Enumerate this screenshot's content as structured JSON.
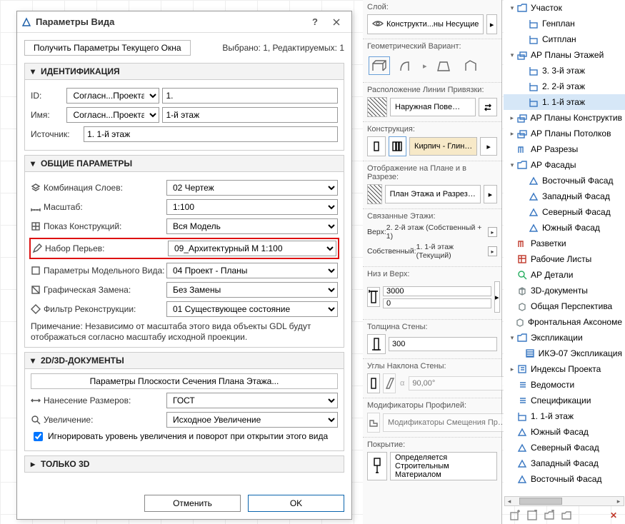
{
  "dialog": {
    "title": "Параметры Вида",
    "get_current": "Получить Параметры Текущего Окна",
    "selection_info": "Выбрано: 1, Редактируемых: 1",
    "section_ident": "ИДЕНТИФИКАЦИЯ",
    "id_label": "ID:",
    "id_mode": "Согласн...Проекта",
    "id_value": "1.",
    "name_label": "Имя:",
    "name_mode": "Согласн...Проекта",
    "name_value": "1-й этаж",
    "source_label": "Источник:",
    "source_value": "1. 1-й этаж",
    "section_general": "ОБЩИЕ ПАРАМЕТРЫ",
    "layers_label": "Комбинация Слоев:",
    "layers_value": "02 Чертеж",
    "scale_label": "Масштаб:",
    "scale_value": "1:100",
    "construct_label": "Показ Конструкций:",
    "construct_value": "Вся Модель",
    "pens_label": "Набор Перьев:",
    "pens_value": "09_Архитектурный М 1:100",
    "mvo_label": "Параметры Модельного Вида:",
    "mvo_value": "04 Проект - Планы",
    "go_label": "Графическая Замена:",
    "go_value": "Без Замены",
    "renov_label": "Фильтр Реконструкции:",
    "renov_value": "01 Существующее состояние",
    "note": "Примечание: Независимо от масштаба этого вида объекты GDL будут отображаться согласно масштабу исходной проекции.",
    "section_2d3d": "2D/3D-ДОКУМЕНТЫ",
    "floorplan_cut_btn": "Параметры Плоскости Сечения Плана Этажа...",
    "dims_label": "Нанесение Размеров:",
    "dims_value": "ГОСТ",
    "zoom_label": "Увеличение:",
    "zoom_value": "Исходное Увеличение",
    "ignore_zoom_chk": "Игнорировать уровень увеличения и поворот при открытии этого вида",
    "section_3donly": "ТОЛЬКО 3D",
    "cancel": "Отменить",
    "ok": "OK"
  },
  "props": {
    "layer_label": "Слой:",
    "layer_value": "Конструкти...ны Несущие",
    "geom_label": "Геометрический Вариант:",
    "refline_label": "Расположение Линии Привязки:",
    "refline_value": "Наружная Пове…",
    "construction_label": "Конструкция:",
    "construction_value": "Кирпич - Глин…",
    "display_label": "Отображение на Плане и в Разрезе:",
    "display_value": "План Этажа и Разрез…",
    "linked_label": "Связанные Этажи:",
    "top_label": "Верх:",
    "top_value": "2. 2-й этаж (Собственный + 1)",
    "own_label": "Собственный:",
    "own_value": "1. 1-й этаж (Текущий)",
    "bottop_label": "Низ и Верх:",
    "h_top": "3000",
    "h_bot": "0",
    "thickness_label": "Толщина Стены:",
    "thickness_value": "300",
    "slant_label": "Углы Наклона Стены:",
    "slant_value": "90,00°",
    "profmod_label": "Модификаторы Профилей:",
    "profmod_value": "Модификаторы Смещения Пр…",
    "surface_label": "Покрытие:",
    "surface_value": "Определяется Строительным Материалом"
  },
  "tree": [
    {
      "indent": 0,
      "caret": "down",
      "iconColor": "#3a78c2",
      "icon": "folder",
      "label": "Участок"
    },
    {
      "indent": 1,
      "caret": "",
      "iconColor": "#3a78c2",
      "icon": "plan",
      "label": "Генплан"
    },
    {
      "indent": 1,
      "caret": "",
      "iconColor": "#3a78c2",
      "icon": "plan",
      "label": "Ситплан"
    },
    {
      "indent": 0,
      "caret": "down",
      "iconColor": "#3a78c2",
      "icon": "plans",
      "label": "АР Планы Этажей"
    },
    {
      "indent": 1,
      "caret": "",
      "iconColor": "#3a78c2",
      "icon": "plan",
      "label": "3. 3-й этаж"
    },
    {
      "indent": 1,
      "caret": "",
      "iconColor": "#3a78c2",
      "icon": "plan",
      "label": "2. 2-й этаж"
    },
    {
      "indent": 1,
      "caret": "",
      "iconColor": "#3a78c2",
      "icon": "plan",
      "label": "1. 1-й этаж",
      "selected": true
    },
    {
      "indent": 0,
      "caret": "right",
      "iconColor": "#3a78c2",
      "icon": "plans",
      "label": "АР Планы Конструктив"
    },
    {
      "indent": 0,
      "caret": "right",
      "iconColor": "#3a78c2",
      "icon": "plans",
      "label": "АР Планы Потолков"
    },
    {
      "indent": 0,
      "caret": "",
      "iconColor": "#3a78c2",
      "icon": "section",
      "label": "АР Разрезы"
    },
    {
      "indent": 0,
      "caret": "down",
      "iconColor": "#3a78c2",
      "icon": "folder",
      "label": "АР Фасады"
    },
    {
      "indent": 1,
      "caret": "",
      "iconColor": "#3a78c2",
      "icon": "elev",
      "label": "Восточный Фасад"
    },
    {
      "indent": 1,
      "caret": "",
      "iconColor": "#3a78c2",
      "icon": "elev",
      "label": "Западный Фасад"
    },
    {
      "indent": 1,
      "caret": "",
      "iconColor": "#3a78c2",
      "icon": "elev",
      "label": "Северный Фасад"
    },
    {
      "indent": 1,
      "caret": "",
      "iconColor": "#3a78c2",
      "icon": "elev",
      "label": "Южный Фасад"
    },
    {
      "indent": 0,
      "caret": "",
      "iconColor": "#c0392b",
      "icon": "section",
      "label": "Разветки"
    },
    {
      "indent": 0,
      "caret": "",
      "iconColor": "#c0392b",
      "icon": "worksheet",
      "label": "Рабочие Листы"
    },
    {
      "indent": 0,
      "caret": "",
      "iconColor": "#27ae60",
      "icon": "detail",
      "label": "АР Детали"
    },
    {
      "indent": 0,
      "caret": "",
      "iconColor": "#7f8c8d",
      "icon": "3ddoc",
      "label": "3D-документы"
    },
    {
      "indent": 0,
      "caret": "",
      "iconColor": "#7f8c8d",
      "icon": "3d",
      "label": "Общая Перспектива"
    },
    {
      "indent": 0,
      "caret": "",
      "iconColor": "#7f8c8d",
      "icon": "3d",
      "label": "Фронтальная Аксономе"
    },
    {
      "indent": 0,
      "caret": "down",
      "iconColor": "#3a78c2",
      "icon": "folder",
      "label": "Экспликации"
    },
    {
      "indent": 1,
      "caret": "",
      "iconColor": "#3a78c2",
      "icon": "schedule",
      "label": "ИКЭ-07 Экспликация"
    },
    {
      "indent": 0,
      "caret": "right",
      "iconColor": "#3a78c2",
      "icon": "index",
      "label": "Индексы Проекта"
    },
    {
      "indent": 0,
      "caret": "",
      "iconColor": "#3a78c2",
      "icon": "list",
      "label": "Ведомости"
    },
    {
      "indent": 0,
      "caret": "",
      "iconColor": "#3a78c2",
      "icon": "list",
      "label": "Спецификации"
    },
    {
      "indent": 0,
      "caret": "",
      "iconColor": "#3a78c2",
      "icon": "plan",
      "label": "1. 1-й этаж"
    },
    {
      "indent": 0,
      "caret": "",
      "iconColor": "#3a78c2",
      "icon": "elev",
      "label": "Южный Фасад"
    },
    {
      "indent": 0,
      "caret": "",
      "iconColor": "#3a78c2",
      "icon": "elev",
      "label": "Северный Фасад"
    },
    {
      "indent": 0,
      "caret": "",
      "iconColor": "#3a78c2",
      "icon": "elev",
      "label": "Западный Фасад"
    },
    {
      "indent": 0,
      "caret": "",
      "iconColor": "#3a78c2",
      "icon": "elev",
      "label": "Восточный Фасад"
    }
  ]
}
